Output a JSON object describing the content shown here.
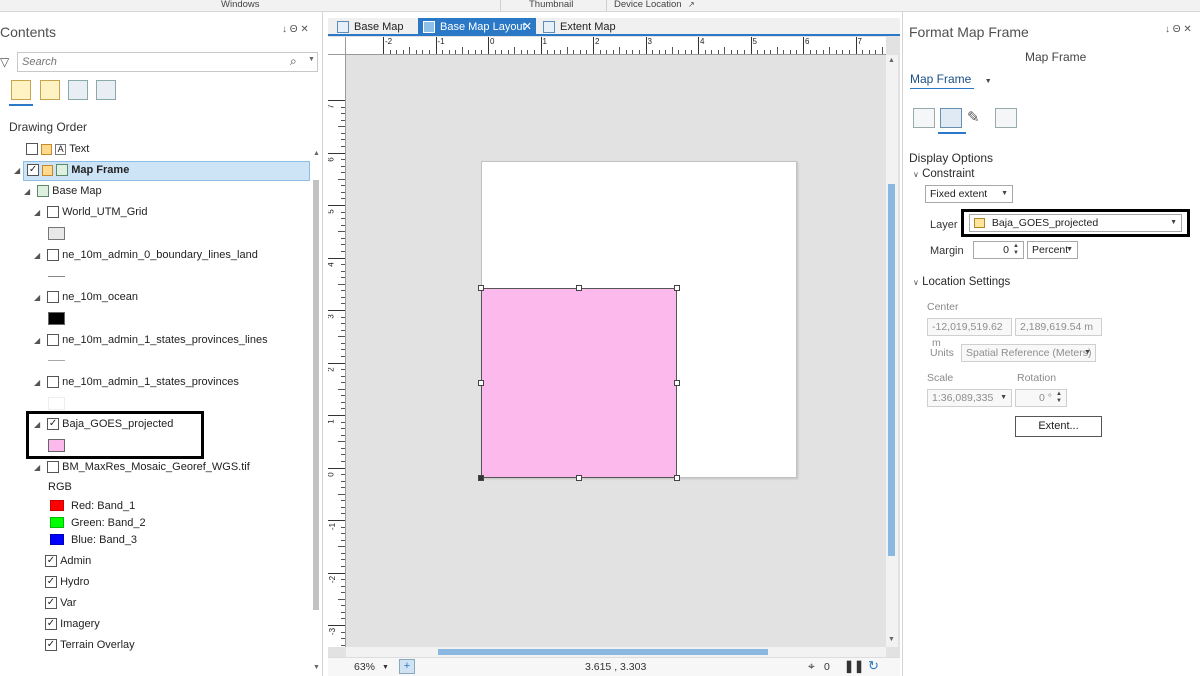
{
  "ribbon": {
    "group1": "Windows",
    "group2": "Thumbnail",
    "group3": "Device Location"
  },
  "contents": {
    "title": "Contents",
    "pin": "↓ Θ ✕",
    "search_placeholder": "Search",
    "section": "Drawing Order",
    "layers": {
      "text": "Text",
      "map_frame": "Map Frame",
      "base_map": "Base Map",
      "utm_grid": "World_UTM_Grid",
      "boundary": "ne_10m_admin_0_boundary_lines_land",
      "ocean": "ne_10m_ocean",
      "states_lines": "ne_10m_admin_1_states_provinces_lines",
      "states": "ne_10m_admin_1_states_provinces",
      "baja": "Baja_GOES_projected",
      "bm": "BM_MaxRes_Mosaic_Georef_WGS.tif",
      "rgb": "RGB",
      "red": "Red:   Band_1",
      "green": "Green:  Band_2",
      "blue": "Blue:  Band_3",
      "admin": "Admin",
      "hydro": "Hydro",
      "var": "Var",
      "imagery": "Imagery",
      "terrain": "Terrain Overlay"
    }
  },
  "tabs": [
    {
      "label": "Base Map"
    },
    {
      "label": "Base Map Layout",
      "close": "✕"
    },
    {
      "label": "Extent Map"
    }
  ],
  "ruler": {
    "h": [
      "-2",
      "-1",
      "0",
      "1",
      "2",
      "3",
      "4",
      "5",
      "6",
      "7"
    ],
    "v": [
      "7",
      "6",
      "5",
      "4",
      "3",
      "2",
      "1",
      "0",
      "-1",
      "-2",
      "-3"
    ]
  },
  "status": {
    "zoom": "63%",
    "coords": "3.615 , 3.303",
    "selected_count": "0"
  },
  "format": {
    "title": "Format Map Frame",
    "pin": "↓ Θ ✕",
    "subtitle": "Map Frame",
    "dropdown_label": "Map Frame",
    "display_options": "Display Options",
    "constraint": "Constraint",
    "constraint_value": "Fixed extent",
    "layer_label": "Layer",
    "layer_value": "Baja_GOES_projected",
    "margin_label": "Margin",
    "margin_value": "0",
    "margin_unit": "Percent",
    "location_settings": "Location Settings",
    "center_label": "Center",
    "center_x": "-12,019,519.62 m",
    "center_y": "2,189,619.54 m",
    "units_label": "Units",
    "units_value": "Spatial Reference (Meters)",
    "scale_label": "Scale",
    "scale_value": "1:36,089,335",
    "rotation_label": "Rotation",
    "rotation_value": "0 °",
    "extent_button": "Extent..."
  },
  "colors": {
    "accent": "#2b78c6",
    "map_frame_fill": "#fbb9ec",
    "baja_swatch": "#fbb9ec",
    "red_band": "#ff0000",
    "green_band": "#00ff00",
    "blue_band": "#0000ff"
  }
}
